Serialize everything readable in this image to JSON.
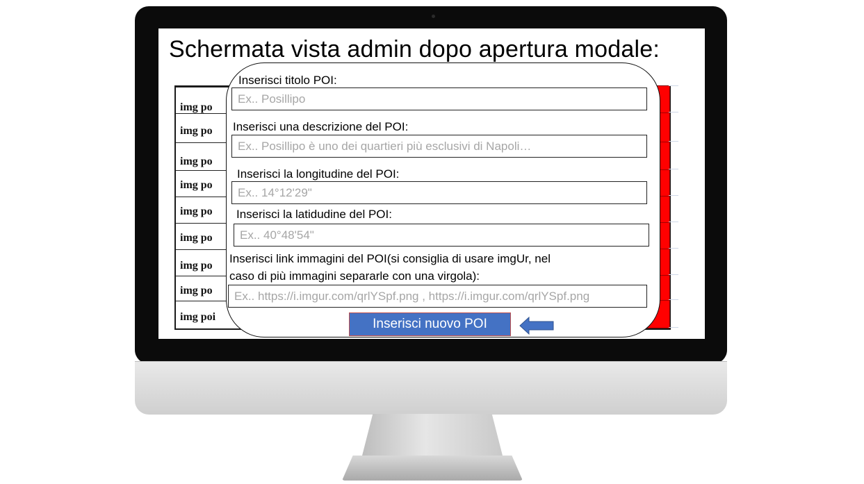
{
  "slide": {
    "title": "Schermata vista admin dopo apertura modale:"
  },
  "table": {
    "rows": [
      "img po",
      "img po",
      "img po",
      "img po",
      "img po",
      "img po",
      "img po",
      "img po",
      "img poi"
    ]
  },
  "modal": {
    "title_label": "Inserisci titolo POI:",
    "title_placeholder": "Ex.. Posillipo",
    "description_label": "Inserisci una descrizione del POI:",
    "description_placeholder": "Ex.. Posillipo è uno dei quartieri più esclusivi di Napoli…",
    "longitude_label": "Inserisci la longitudine del POI:",
    "longitude_placeholder": "Ex.. 14°12'29\"",
    "latitude_label": "Inserisci la latidudine del POI:",
    "latitude_placeholder": "Ex.. 40°48'54\"",
    "images_label_line1": "Inserisci link immagini del POI(si consiglia di usare imgUr, nel",
    "images_label_line2": "caso di più immagini separarle con una virgola):",
    "images_placeholder": "Ex.. https://i.imgur.com/qrlYSpf.png , https://i.imgur.com/qrlYSpf.png",
    "submit_label": "Inserisci nuovo POI"
  },
  "colors": {
    "button": "#4472c4",
    "button_border": "#c0504d",
    "arrow": "#4472c4",
    "table_accent": "#ff0000"
  },
  "icons": {
    "pointer": "left-arrow-icon"
  }
}
